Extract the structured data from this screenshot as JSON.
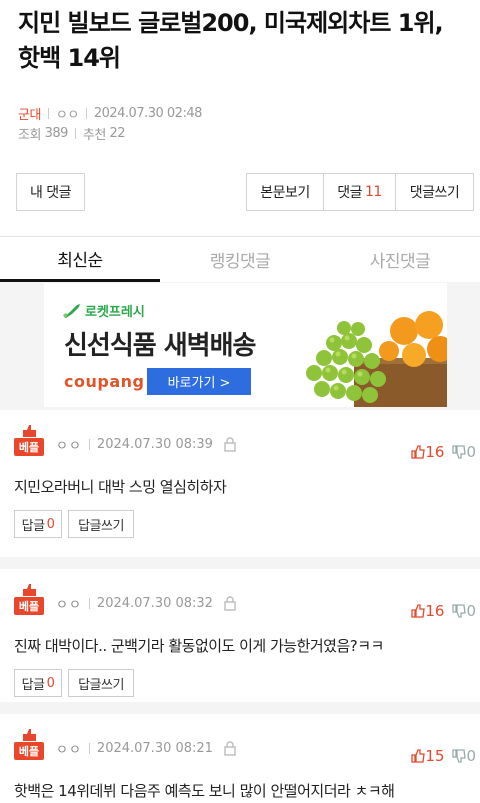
{
  "article": {
    "title": "지민 빌보드 글로벌200, 미국제외차트 1위, 핫백 14위",
    "category": "군대",
    "author": "ㅇㅇ",
    "datetime": "2024.07.30 02:48",
    "views_label": "조회",
    "views": "389",
    "recommend_label": "추천",
    "recommend": "22"
  },
  "actions": {
    "my_comments": "내 댓글",
    "view_body": "본문보기",
    "comments_label": "댓글",
    "comments_count": "11",
    "write_comment": "댓글쓰기"
  },
  "tabs": [
    {
      "label": "최신순",
      "active": true
    },
    {
      "label": "랭킹댓글",
      "active": false
    },
    {
      "label": "사진댓글",
      "active": false
    }
  ],
  "ad": {
    "tagline": "로켓프레시",
    "headline": "신선식품 새벽배송",
    "brand": "coupang",
    "button": "바로가기 >"
  },
  "comments": [
    {
      "badge": "베플",
      "author": "ㅇㅇ",
      "datetime": "2024.07.30 08:39",
      "up": "16",
      "down": "0",
      "text": "지민오라버니 대박 스밍 열심히하자",
      "reply_label": "답글",
      "reply_count": "0",
      "write_reply": "답글쓰기"
    },
    {
      "badge": "베플",
      "author": "ㅇㅇ",
      "datetime": "2024.07.30 08:32",
      "up": "16",
      "down": "0",
      "text": "진짜 대박이다.. 군백기라 활동없이도 이게 가능한거였음?ㅋㅋ",
      "reply_label": "답글",
      "reply_count": "0",
      "write_reply": "답글쓰기"
    },
    {
      "badge": "베플",
      "author": "ㅇㅇ",
      "datetime": "2024.07.30 08:21",
      "up": "15",
      "down": "0",
      "text": "핫백은 14위데뷔 다음주 예측도 보니 많이 안떨어지더라 ㅊㅋ해"
    }
  ],
  "colors": {
    "accent": "#e8472b",
    "ad_button": "#2d6de0",
    "ad_tagline": "#2aa84a"
  }
}
